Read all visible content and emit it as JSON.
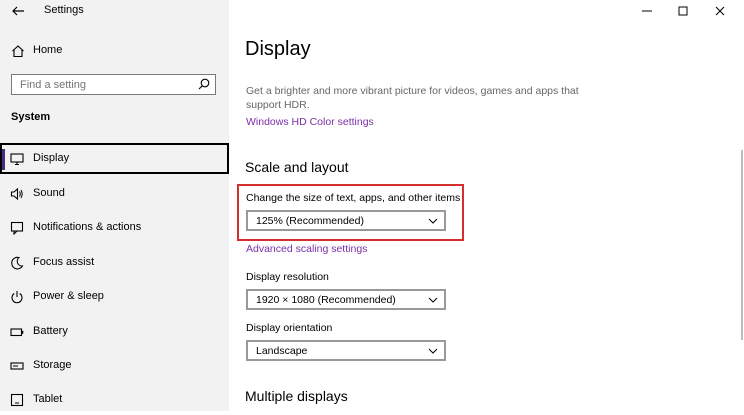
{
  "window": {
    "title": "Settings",
    "controls": {
      "minimize": "minimize-icon",
      "maximize": "maximize-icon",
      "close": "close-icon"
    }
  },
  "sidebar": {
    "home_label": "Home",
    "search_placeholder": "Find a setting",
    "section_heading": "System",
    "items": [
      {
        "label": "Display",
        "icon": "monitor-icon",
        "selected": true
      },
      {
        "label": "Sound",
        "icon": "speaker-icon"
      },
      {
        "label": "Notifications & actions",
        "icon": "notification-icon"
      },
      {
        "label": "Focus assist",
        "icon": "moon-icon"
      },
      {
        "label": "Power & sleep",
        "icon": "power-icon"
      },
      {
        "label": "Battery",
        "icon": "battery-icon"
      },
      {
        "label": "Storage",
        "icon": "storage-icon"
      },
      {
        "label": "Tablet",
        "icon": "tablet-icon"
      }
    ]
  },
  "main": {
    "title": "Display",
    "hdr_description": "Get a brighter and more vibrant picture for videos, games and apps that support HDR.",
    "hdr_link": "Windows HD Color settings",
    "scale_section_title": "Scale and layout",
    "scale_label": "Change the size of text, apps, and other items",
    "scale_value": "125% (Recommended)",
    "advanced_scaling_link": "Advanced scaling settings",
    "resolution_label": "Display resolution",
    "resolution_value": "1920 × 1080 (Recommended)",
    "orientation_label": "Display orientation",
    "orientation_value": "Landscape",
    "multiple_displays_title": "Multiple displays"
  },
  "colors": {
    "link": "#7b2fa8",
    "highlight_box": "#d32f2f",
    "selected_accent": "#4c2b87",
    "sidebar_bg": "#f2f2f2"
  }
}
